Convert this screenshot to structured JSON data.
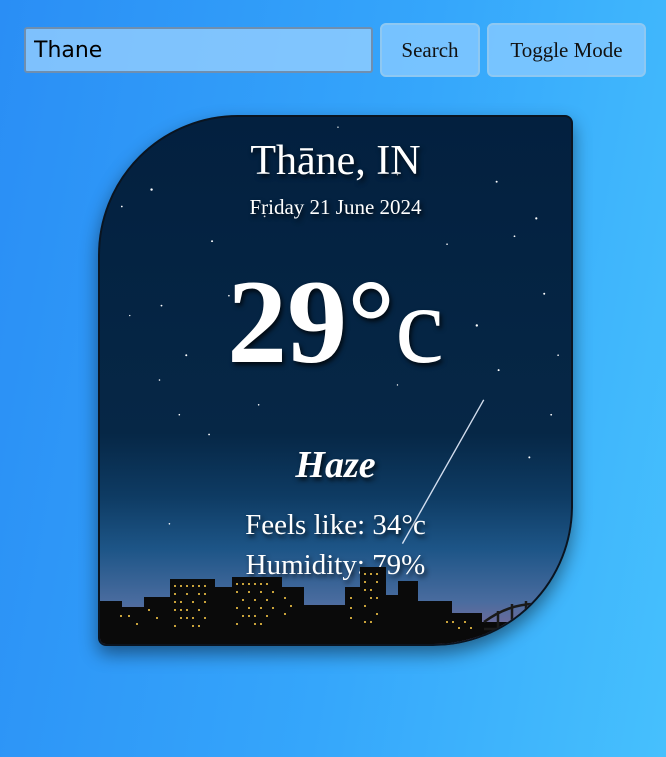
{
  "search": {
    "value": "Thane"
  },
  "buttons": {
    "search_label": "Search",
    "toggle_label": "Toggle Mode"
  },
  "weather": {
    "city": "Thāne, IN",
    "date": "Friday 21 June 2024",
    "temperature": "29°",
    "unit": "c",
    "condition": "Haze",
    "feels_like": "Feels like: 34°c",
    "humidity": "Humidity: 79%"
  },
  "colors": {
    "background": "#35a6fb",
    "card_sky": "#03203f"
  },
  "icons": {
    "background_art": "night-city-skyline"
  }
}
